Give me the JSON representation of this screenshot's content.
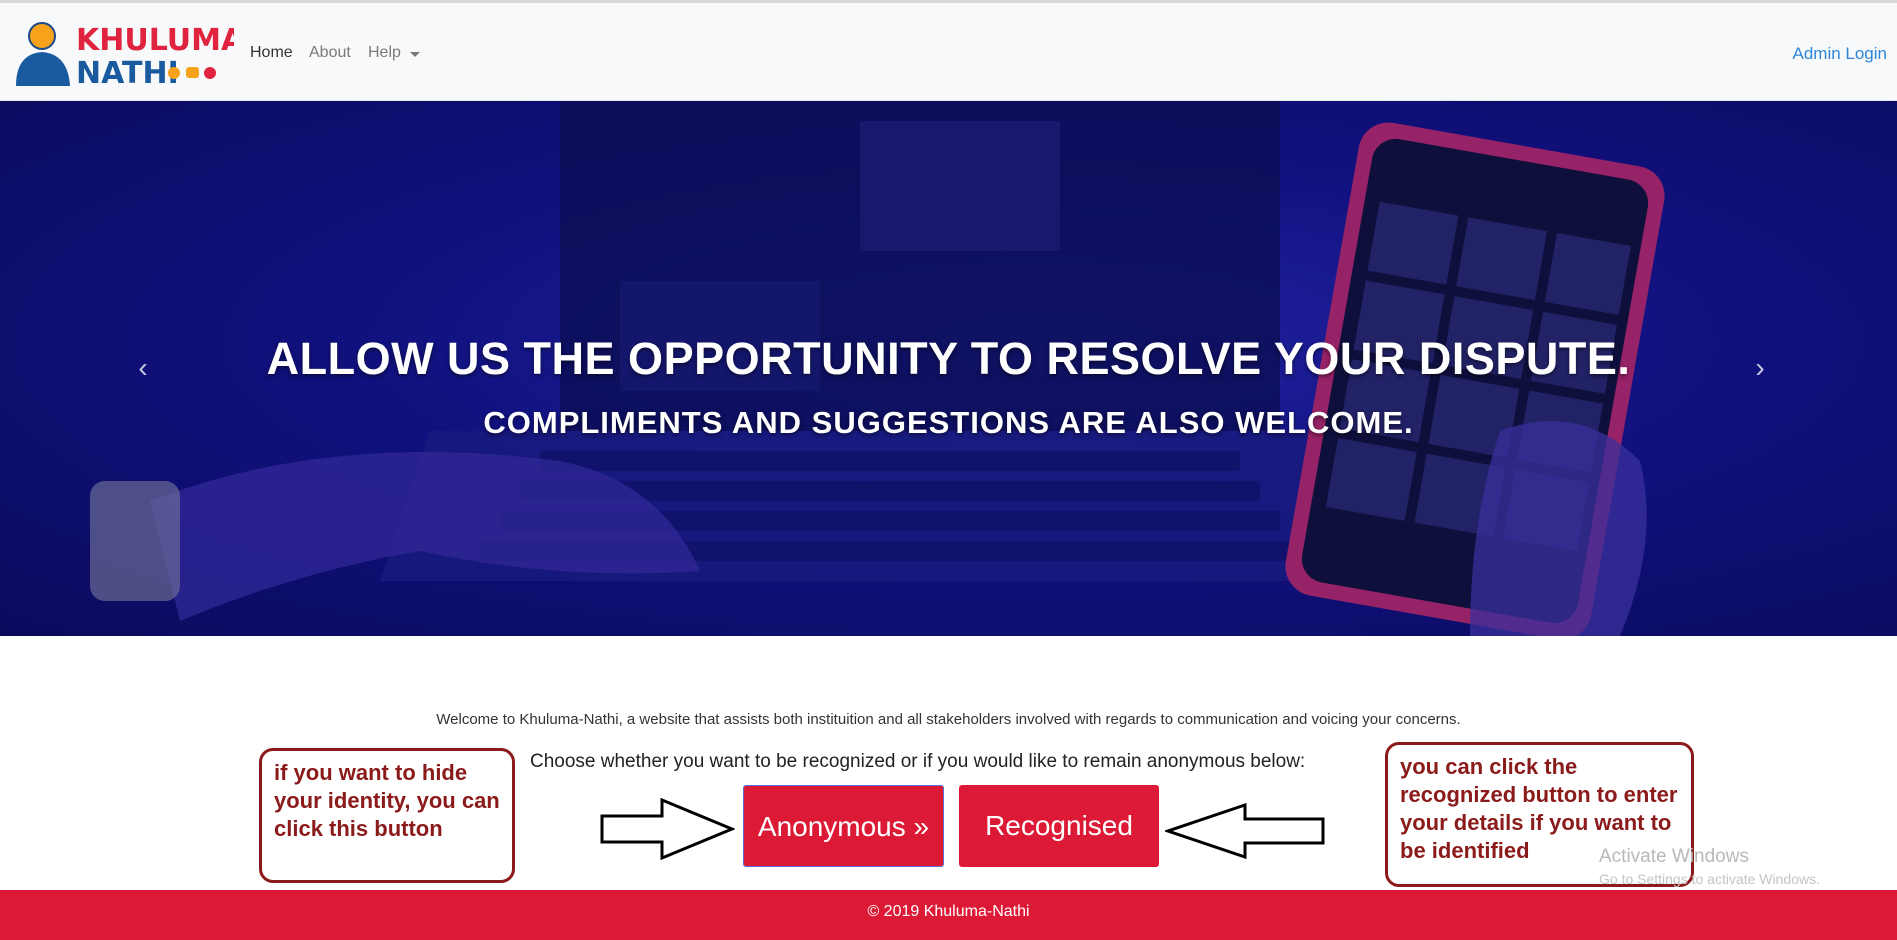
{
  "brand": {
    "line1": "KHULUMA",
    "line2": "NATHI"
  },
  "nav": {
    "home": "Home",
    "about": "About",
    "help": "Help",
    "admin_login": "Admin Login"
  },
  "hero": {
    "title": "ALLOW US THE OPPORTUNITY TO RESOLVE YOUR DISPUTE.",
    "subtitle": "COMPLIMENTS AND SUGGESTIONS ARE ALSO WELCOME.",
    "prev_icon": "‹",
    "next_icon": "›"
  },
  "content": {
    "welcome": "Welcome to Khuluma-Nathi, a website that assists both instituition and all stakeholders involved with regards to communication and voicing your concerns.",
    "choose": "Choose whether you want to be recognized or if you would like to remain anonymous below:",
    "anonymous_button": "Anonymous »",
    "recognised_button": "Recognised"
  },
  "annotations": {
    "left": "if you want to hide your identity, you can click this button",
    "right": "you can click the recognized button to enter your details if you want to be identified"
  },
  "watermark": {
    "line1": "Activate Windows",
    "line2": "Go to Settings to activate Windows."
  },
  "footer": {
    "text": "© 2019 Khuluma-Nathi"
  },
  "colors": {
    "brand_red": "#dc1a36",
    "link_blue": "#2f86d6",
    "annotation": "#8b1a1a"
  }
}
